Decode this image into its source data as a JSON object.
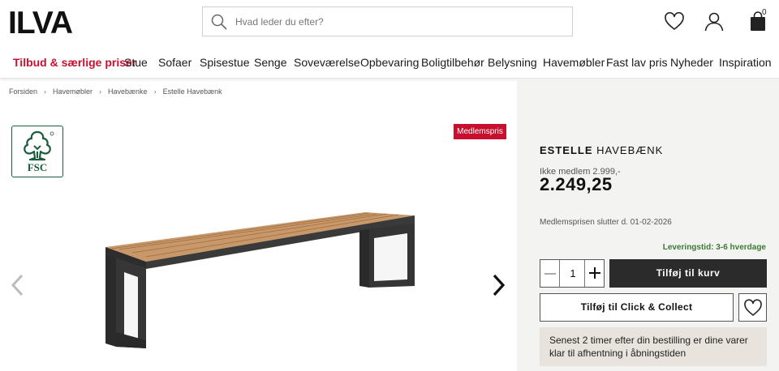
{
  "header": {
    "logo_text": "ILVA",
    "search_placeholder": "Hvad leder du efter?",
    "cart_count": "0"
  },
  "nav": {
    "items": [
      {
        "label": "Tilbud & særlige priser"
      },
      {
        "label": "Stue"
      },
      {
        "label": "Sofaer"
      },
      {
        "label": "Spisestue"
      },
      {
        "label": "Senge"
      },
      {
        "label": "Soveværelse"
      },
      {
        "label": "Opbevaring"
      },
      {
        "label": "Boligtilbehør"
      },
      {
        "label": "Belysning"
      },
      {
        "label": "Havemøbler"
      },
      {
        "label": "Fast lav pris"
      },
      {
        "label": "Nyheder"
      },
      {
        "label": "Inspiration"
      }
    ]
  },
  "breadcrumb": {
    "items": [
      "Forsiden",
      "Havemøbler",
      "Havebænke",
      "Estelle Havebænk"
    ],
    "separator": "›"
  },
  "gallery": {
    "badge": "Medlemspris",
    "fsc_label": "FSC"
  },
  "product": {
    "name": "ESTELLE",
    "category": "HAVEBÆNK",
    "old_price": "Ikke medlem 2.999,-",
    "price": "2.249,25",
    "member_end": "Medlemsprisen slutter d. 01-02-2026",
    "delivery": "Leveringstid: 3-6 hverdage",
    "quantity": "1",
    "add_to_cart": "Tilføj til kurv",
    "click_collect": "Tilføj til Click & Collect",
    "pickup_info": "Senest 2 timer efter din bestilling er dine varer klar til afhentning i åbningstiden"
  },
  "colors": {
    "accent_red": "#c8102e",
    "delivery_green": "#3b7a34",
    "button_dark": "#2b2b2b",
    "panel_bg": "#f3f3f1",
    "fsc_green": "#1b5c3b"
  },
  "icons": [
    "search-icon",
    "heart-icon",
    "user-icon",
    "cart-icon",
    "fsc-tree-icon",
    "chevron-left-icon",
    "chevron-right-icon",
    "minus-icon",
    "plus-icon"
  ]
}
